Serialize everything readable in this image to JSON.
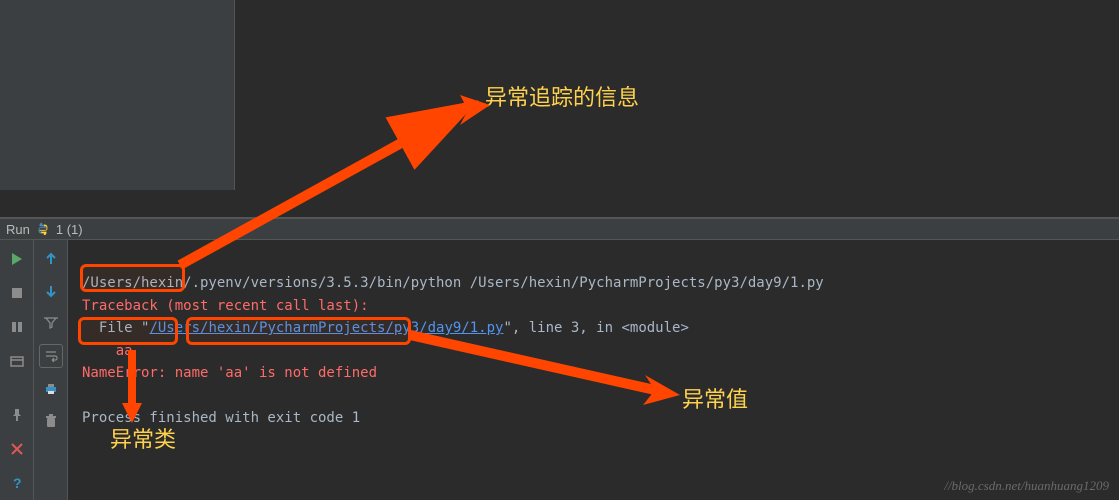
{
  "run_header": {
    "label": "Run",
    "config": "1 (1)"
  },
  "console": {
    "cmd": "/Users/hexin/.pyenv/versions/3.5.3/bin/python /Users/hexin/PycharmProjects/py3/day9/1.py",
    "traceback": "Traceback (most recent call last):",
    "file_prefix": "  File \"",
    "file_link": "/Users/hexin/PycharmProjects/py3/day9/1.py",
    "file_suffix": "\", line 3, in <module>",
    "aa": "    aa",
    "error": "NameError: name 'aa' is not defined",
    "exit": "Process finished with exit code 1"
  },
  "annotations": {
    "trace_info": "异常追踪的信息",
    "exc_type": "异常类",
    "exc_value": "异常值"
  },
  "watermark": "//blog.csdn.net/huanhuang1209"
}
